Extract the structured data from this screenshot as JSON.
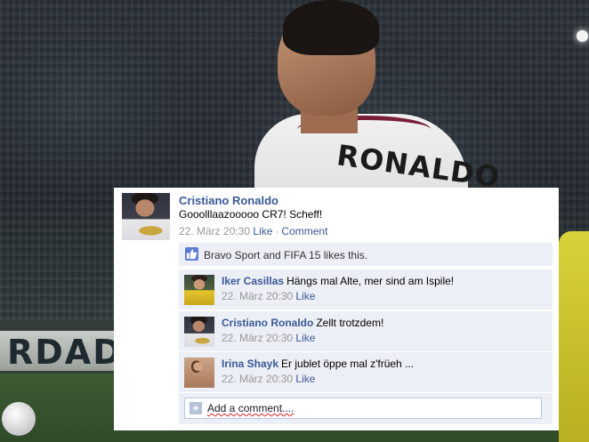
{
  "background": {
    "shirt_text": "RONALDO",
    "ad_board_text": "RDAD"
  },
  "post": {
    "author": "Cristiano Ronaldo",
    "text": "Gooolllaazooooo CR7! Scheff!",
    "timestamp": "22. März 20:30",
    "like_label": "Like",
    "comment_label": "Comment",
    "separator": "·"
  },
  "likes": {
    "icon": "thumbs-up-icon",
    "text": "Bravo Sport and FIFA 15 likes this."
  },
  "comments": [
    {
      "author": "Iker Casillas",
      "text": "Hängs mal Alte, mer sind am Ispile!",
      "timestamp": "22. März 20:30",
      "like_label": "Like"
    },
    {
      "author": "Cristiano Ronaldo",
      "text": "Zellt trotzdem!",
      "timestamp": "22. März 20:30",
      "like_label": "Like"
    },
    {
      "author": "Irina Shayk",
      "text": "Er jublet öppe mal z'früeh ...",
      "timestamp": "22. März 20:30",
      "like_label": "Like"
    }
  ],
  "add_comment": {
    "icon": "plus-icon",
    "placeholder": "Add a comment....",
    "icon_glyph": "+"
  },
  "colors": {
    "link": "#3b5998",
    "panel": "#eceff5",
    "meta": "#999999"
  }
}
